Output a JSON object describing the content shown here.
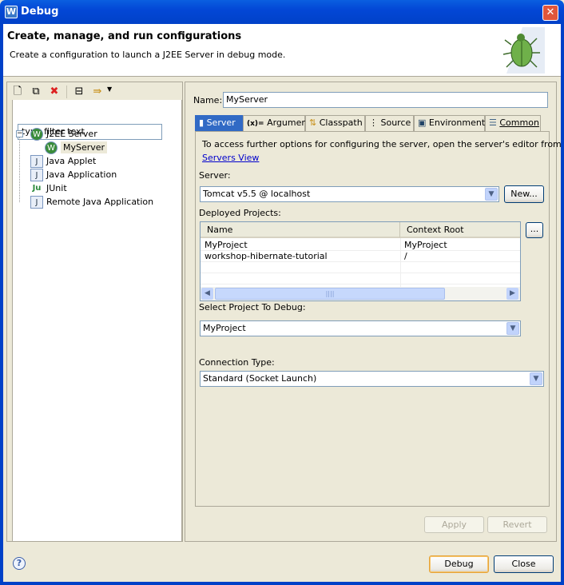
{
  "window": {
    "title": "Debug",
    "app_icon": "eclipse-w-icon",
    "close_icon": "close-x-icon"
  },
  "header": {
    "title": "Create, manage, and run configurations",
    "subtitle": "Create a configuration to launch a J2EE Server in debug mode.",
    "image": "debug-bug-icon"
  },
  "left": {
    "toolbar": [
      "new-configuration-icon",
      "duplicate-icon",
      "delete-icon",
      "collapse-all-icon",
      "filter-icon"
    ],
    "filter_placeholder": "type filter text",
    "tree": [
      {
        "label": "J2EE Server",
        "expanded": true,
        "children": [
          {
            "label": "MyServer",
            "selected": true
          }
        ]
      },
      {
        "label": "Java Applet"
      },
      {
        "label": "Java Application"
      },
      {
        "label": "JUnit"
      },
      {
        "label": "Remote Java Application"
      }
    ]
  },
  "right": {
    "name_label": "Name:",
    "name_value": "MyServer",
    "tabs": [
      "Server",
      "Arguments",
      "Classpath",
      "Source",
      "Environment",
      "Common"
    ],
    "active_tab": "Server",
    "info_text": "To access further options for configuring the server, open the server's editor from",
    "servers_link": "Servers View",
    "server_label": "Server:",
    "server_value": "Tomcat v5.5 @ localhost",
    "new_button": "New...",
    "deployed_label": "Deployed Projects:",
    "table": {
      "columns": [
        "Name",
        "Context Root"
      ],
      "rows": [
        [
          "MyProject",
          "MyProject"
        ],
        [
          "workshop-hibernate-tutorial",
          "/"
        ]
      ]
    },
    "ellipsis_button": "...",
    "select_project_label": "Select Project To Debug:",
    "select_project_value": "MyProject",
    "connection_label": "Connection Type:",
    "connection_value": "Standard (Socket Launch)",
    "apply": "Apply",
    "revert": "Revert"
  },
  "footer": {
    "debug": "Debug",
    "close": "Close",
    "help_icon": "help-icon"
  }
}
